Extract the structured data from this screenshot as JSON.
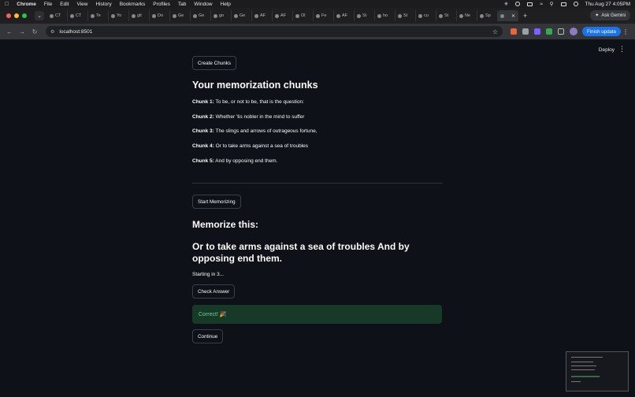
{
  "menubar": {
    "items": [
      "Chrome",
      "File",
      "Edit",
      "View",
      "History",
      "Bookmarks",
      "Profiles",
      "Tab",
      "Window",
      "Help"
    ],
    "datetime": "Thu Aug 27  4:05PM"
  },
  "tabs": [
    "CT",
    "CT",
    "Te",
    "Yo",
    "git",
    "Do",
    "Ge",
    "Ge",
    "go",
    "Ge",
    "AF",
    "AF",
    "Ol",
    "Fe",
    "AF",
    "St",
    "ho",
    "St",
    "cu",
    "St",
    "Ne",
    "Sp",
    ""
  ],
  "ask_gemini": "Ask Gemini",
  "address": {
    "url": "localhost:8501",
    "finish_update": "Finish update"
  },
  "app": {
    "deploy": "Deploy",
    "create_chunks": "Create Chunks",
    "chunks_heading": "Your memorization chunks",
    "chunks": [
      {
        "label": "Chunk 1:",
        "text": "To be, or not to be, that is the question:"
      },
      {
        "label": "Chunk 2:",
        "text": "Whether 'tis nobler in the mind to suffer"
      },
      {
        "label": "Chunk 3:",
        "text": "The slings and arrows of outrageous fortune,"
      },
      {
        "label": "Chunk 4:",
        "text": "Or to take arms against a sea of troubles"
      },
      {
        "label": "Chunk 5:",
        "text": "And by opposing end them."
      }
    ],
    "start_memorizing": "Start Memorizing",
    "memorize_heading": "Memorize this:",
    "memorize_text": "Or to take arms against a sea of troubles And by opposing end them.",
    "countdown": "Starting in 3...",
    "check_answer": "Check Answer",
    "success_message": "Correct! 🎉",
    "continue": "Continue"
  },
  "colors": {
    "background": "#0e1117",
    "success_bg": "#173928",
    "success_text": "#6fcf97",
    "accent": "#1a73e8"
  }
}
